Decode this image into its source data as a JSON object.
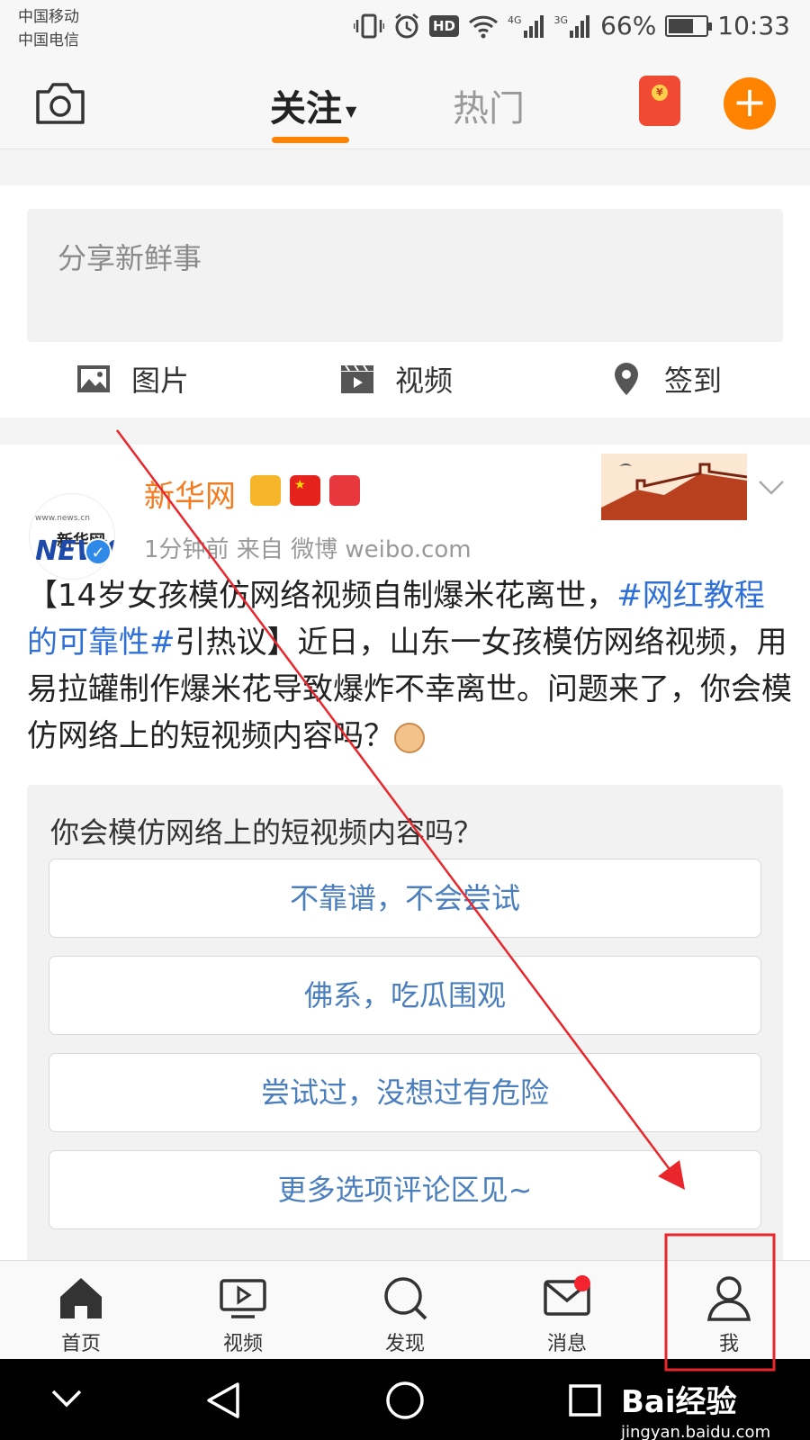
{
  "status_bar": {
    "carrier_1": "中国移动",
    "carrier_2": "中国电信",
    "network_1": "4G",
    "network_2": "3G",
    "hd_label": "HD",
    "battery": "66%",
    "battery_level": 0.66,
    "time": "10:33"
  },
  "top_nav": {
    "tab_follow": "关注",
    "tab_hot": "热门",
    "active_color": "#ff8200",
    "icons": [
      "camera-icon",
      "red-packet-icon",
      "plus-icon"
    ]
  },
  "composer": {
    "placeholder": "分享新鲜事",
    "actions": [
      {
        "label": "图片",
        "icon": "image-icon"
      },
      {
        "label": "视频",
        "icon": "video-icon"
      },
      {
        "label": "签到",
        "icon": "location-icon"
      }
    ]
  },
  "post": {
    "author": "新华网",
    "avatar_lines": [
      "www.news.cn",
      "新华网",
      "NEWS"
    ],
    "meta": "1分钟前   来自 微博 weibo.com",
    "text_part_1": "【14岁女孩模仿网络视频自制爆米花离世，",
    "hashtag": "#网红教程的可靠性#",
    "text_part_2": "引热议】近日，山东一女孩模仿网络视频，用易拉罐制作爆米花导致爆炸不幸离世。问题来了，你会模仿网络上的短视频内容吗？",
    "author_color": "#f47c20",
    "hashtag_color": "#2f6fd8"
  },
  "poll": {
    "question": "你会模仿网络上的短视频内容吗？",
    "options": [
      "不靠谱，不会尝试",
      "佛系，吃瓜围观",
      "尝试过，没想过有危险",
      "更多选项评论区见~"
    ]
  },
  "tab_bar": {
    "items": [
      {
        "label": "首页",
        "icon": "home-icon"
      },
      {
        "label": "视频",
        "icon": "video-play-icon"
      },
      {
        "label": "发现",
        "icon": "search-icon"
      },
      {
        "label": "消息",
        "icon": "mail-icon"
      },
      {
        "label": "我",
        "icon": "profile-icon"
      }
    ]
  },
  "watermark": {
    "logo": "Bai经验",
    "url": "jingyan.baidu.com"
  },
  "annotation_color": "#e8262c"
}
